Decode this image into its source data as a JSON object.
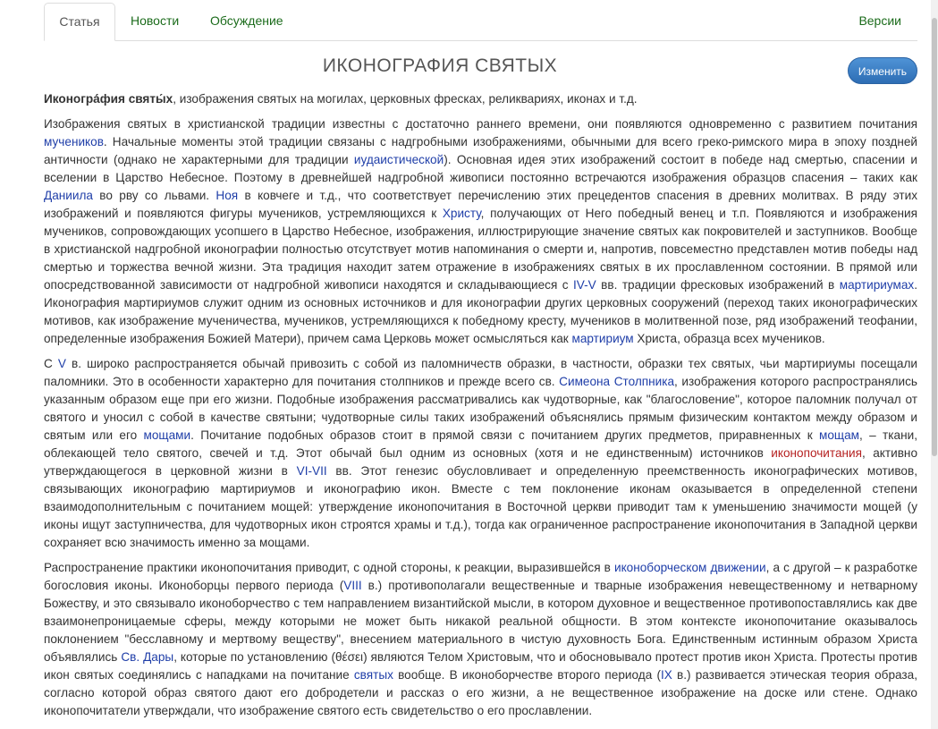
{
  "tabs": {
    "article": "Статья",
    "news": "Новости",
    "discussion": "Обсуждение",
    "versions": "Версии"
  },
  "title": "ИКОНОГРАФИЯ СВЯТЫХ",
  "edit_label": "Изменить",
  "lead": {
    "term": "Иконогра́фия святы́х",
    "rest": ", изображения святых на могилах, церковных фресках, реликвариях, иконах и т.д."
  },
  "p1": {
    "s1": "Изображения святых в христианской традиции известны с достаточно раннего времени, они появляются одновременно с развитием почитания ",
    "l1": "мучеников",
    "s2": ". Начальные моменты этой традиции связаны с надгробными изображениями, обычными для всего греко-римского мира в эпоху поздней античности (однако не характерными для традиции ",
    "l2": "иудаистической",
    "s3": "). Основная идея этих изображений состоит в победе над смертью, спасении и вселении в Царство Небесное. Поэтому в древнейшей надгробной живописи постоянно встречаются изображения образцов спасения – таких как ",
    "l3": "Даниила",
    "s4": " во рву со львами. ",
    "l4": "Ноя",
    "s5": " в ковчеге и т.д., что соответствует перечислению этих прецедентов спасения в древних молитвах. В ряду этих изображений и появляются фигуры мучеников, устремляющихся к ",
    "l5": "Христу",
    "s6": ", получающих от Него победный венец и т.п. Появляются и изображения мучеников, сопровождающих усопшего в Царство Небесное, изображения, иллюстрирующие значение святых как покровителей и заступников. Вообще в христианской надгробной иконографии полностью отсутствует мотив напоминания о смерти и, напротив, повсеместно представлен мотив победы над смертью и торжества вечной жизни. Эта традиция находит затем отражение в изображениях святых в их прославленном состоянии. В прямой или опосредствованной зависимости от надгробной живописи находятся и складывающиеся с ",
    "l6": "IV-V",
    "s7": " вв. традиции фресковых изображений в ",
    "l7": "мартириумах",
    "s8": ". Иконография мартириумов служит одним из основных источников и для иконографии других церковных сооружений (переход таких иконографических мотивов, как изображение мученичества, мучеников, устремляющихся к победному кресту, мучеников в молитвенной позе, ряд изображений теофании, определенные изображения Божией Матери), причем сама Церковь может осмысляться как ",
    "l8": "мартириум",
    "s9": " Христа, образца всех мучеников."
  },
  "p2": {
    "s1": "С ",
    "l1": "V",
    "s2": " в. широко распространяется обычай привозить с собой из паломничеств образки, в частности, образки тех святых, чьи мартириумы посещали паломники. Это в особенности характерно для почитания столпников и прежде всего св. ",
    "l2": "Симеона Столпника",
    "s3": ", изображения которого распространялись указанным образом еще при его жизни. Подобные изображения рассматривались как чудотворные, как \"благословение\", которое паломник получал от святого и уносил с собой в качестве святыни; чудотворные силы таких изображений объяснялись прямым физическим контактом между образом и святым или его ",
    "l3": "мощами",
    "s4": ". Почитание подобных образов стоит в прямой связи с почитанием других предметов, приравненных к ",
    "l4": "мощам",
    "s5": ", – ткани, облекающей тело святого, свечей и т.д. Этот обычай был одним из основных (хотя и не единственным) источников ",
    "l5": "иконопочитания",
    "s6": ", активно утверждающегося в церковной жизни в ",
    "l6": "VI-VII",
    "s7": " вв. Этот генезис обусловливает и определенную преемственность иконографических мотивов, связывающих иконографию мартириумов и иконографию икон. Вместе с тем поклонение иконам оказывается в определенной степени взаимодополнительным с почитанием мощей: утверждение иконопочитания в Восточной церкви приводит там к уменьшению значимости мощей (у иконы ищут заступничества, для чудотворных икон строятся храмы и т.д.), тогда как ограниченное распространение иконопочитания в Западной церкви сохраняет всю значимость именно за мощами."
  },
  "p3": {
    "s1": "Распространение практики иконопочитания приводит, с одной стороны, к реакции, выразившейся в ",
    "l1": "иконоборческом движении",
    "s2": ", а с другой – к разработке богословия иконы. Иконоборцы первого периода (",
    "l2": "VIII",
    "s3": " в.) противополагали вещественные и тварные изображения невещественному и нетварному Божеству, и это связывало иконоборчество с тем направлением византийской мысли, в котором духовное и вещественное противопоставлялись как две взаимонепроницаемые сферы, между которыми не может быть никакой реальной общности. В этом контексте иконопочитание оказывалось поклонением \"бесславному и мертвому веществу\", внесением материального в чистую духовность Бога. Единственным истинным образом Христа объявлялись ",
    "l3": "Св. Дары",
    "s4": ", которые по установлению (θέσει) являются Телом Христовым, что и обосновывало протест против икон Христа. Протесты против икон святых соединялись с нападками на почитание ",
    "l4": "святых",
    "s5": " вообще. В иконоборчестве второго периода (",
    "l5": "IX",
    "s6": " в.) развивается этическая теория образа, согласно которой образ святого дают его добродетели и рассказ о его жизни, а не вещественное изображение на доске или стене. Однако иконопочитатели утверждали, что изображение святого есть свидетельство о его прославлении."
  }
}
